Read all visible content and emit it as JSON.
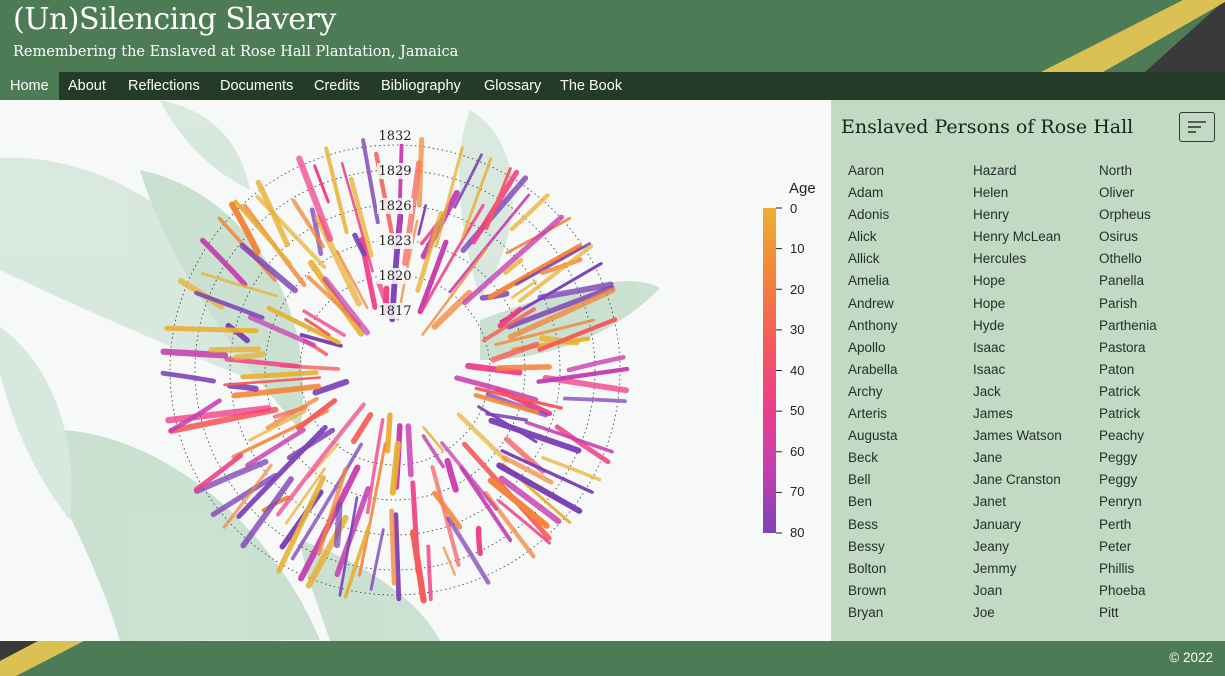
{
  "header": {
    "title": "(Un)Silencing Slavery",
    "subtitle": "Remembering the Enslaved at Rose Hall Plantation, Jamaica"
  },
  "nav": {
    "items": [
      "Home",
      "About",
      "Reflections",
      "Documents",
      "Credits",
      "Bibliography",
      "Glossary",
      "The Book"
    ],
    "active": "Home"
  },
  "viz": {
    "year_labels": [
      "1832",
      "1829",
      "1826",
      "1823",
      "1820",
      "1817"
    ],
    "legend": {
      "title": "Age",
      "ticks": [
        "0",
        "10",
        "20",
        "30",
        "40",
        "50",
        "60",
        "70",
        "80"
      ],
      "colors": [
        "#e8b033",
        "#f2863a",
        "#f65c5a",
        "#ef3e86",
        "#c63fb0",
        "#7d42b6"
      ]
    }
  },
  "panel": {
    "title": "Enslaved Persons of Rose Hall",
    "sort_icon": "sort-lines-icon",
    "names": [
      [
        "Aaron",
        "Adam",
        "Adonis",
        "Alick",
        "Allick",
        "Amelia",
        "Andrew",
        "Anthony",
        "Apollo",
        "Arabella",
        "Archy",
        "Arteris",
        "Augusta",
        "Beck",
        "Bell",
        "Ben",
        "Bess",
        "Bessy",
        "Bolton",
        "Brown",
        "Bryan"
      ],
      [
        "Hazard",
        "Helen",
        "Henry",
        "Henry McLean",
        "Hercules",
        "Hope",
        "Hope",
        "Hyde",
        "Isaac",
        "Isaac",
        "Jack",
        "James",
        "James Watson",
        "Jane",
        "Jane Cranston",
        "Janet",
        "January",
        "Jeany",
        "Jemmy",
        "Joan",
        "Joe"
      ],
      [
        "North",
        "Oliver",
        "Orpheus",
        "Osirus",
        "Othello",
        "Panella",
        "Parish",
        "Parthenia",
        "Pastora",
        "Paton",
        "Patrick",
        "Patrick",
        "Peachy",
        "Peggy",
        "Peggy",
        "Penryn",
        "Perth",
        "Peter",
        "Phillis",
        "Phoeba",
        "Pitt"
      ]
    ]
  },
  "footer": {
    "copyright": "© 2022"
  },
  "colors": {
    "header_green": "#4d7b55",
    "nav_dark": "#243b27",
    "panel_bg": "#c2d9c4",
    "flag_gold": "#dbc153",
    "flag_black": "#3a3a3a"
  }
}
